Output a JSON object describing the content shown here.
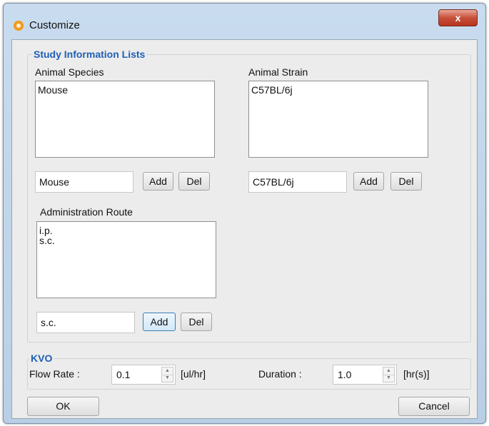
{
  "window": {
    "title": "Customize",
    "close_glyph": "x"
  },
  "study_info": {
    "title": "Study Information Lists",
    "species": {
      "label": "Animal Species",
      "items": [
        "Mouse"
      ],
      "input_value": "Mouse"
    },
    "strain": {
      "label": "Animal Strain",
      "items": [
        "C57BL/6j"
      ],
      "input_value": "C57BL/6j"
    },
    "route": {
      "label": "Administration Route",
      "items": [
        "i.p.",
        "s.c."
      ],
      "input_value": "s.c."
    },
    "add_label": "Add",
    "del_label": "Del"
  },
  "kvo": {
    "title": "KVO",
    "flow_rate": {
      "label": "Flow Rate :",
      "value": "0.1",
      "unit": "[ul/hr]"
    },
    "duration": {
      "label": "Duration :",
      "value": "1.0",
      "unit": "[hr(s)]"
    }
  },
  "footer": {
    "ok_label": "OK",
    "cancel_label": "Cancel"
  },
  "colors": {
    "group_title": "#1f5fb6",
    "close_button": "#c7503a",
    "focused_button_border": "#3c7fb1"
  }
}
